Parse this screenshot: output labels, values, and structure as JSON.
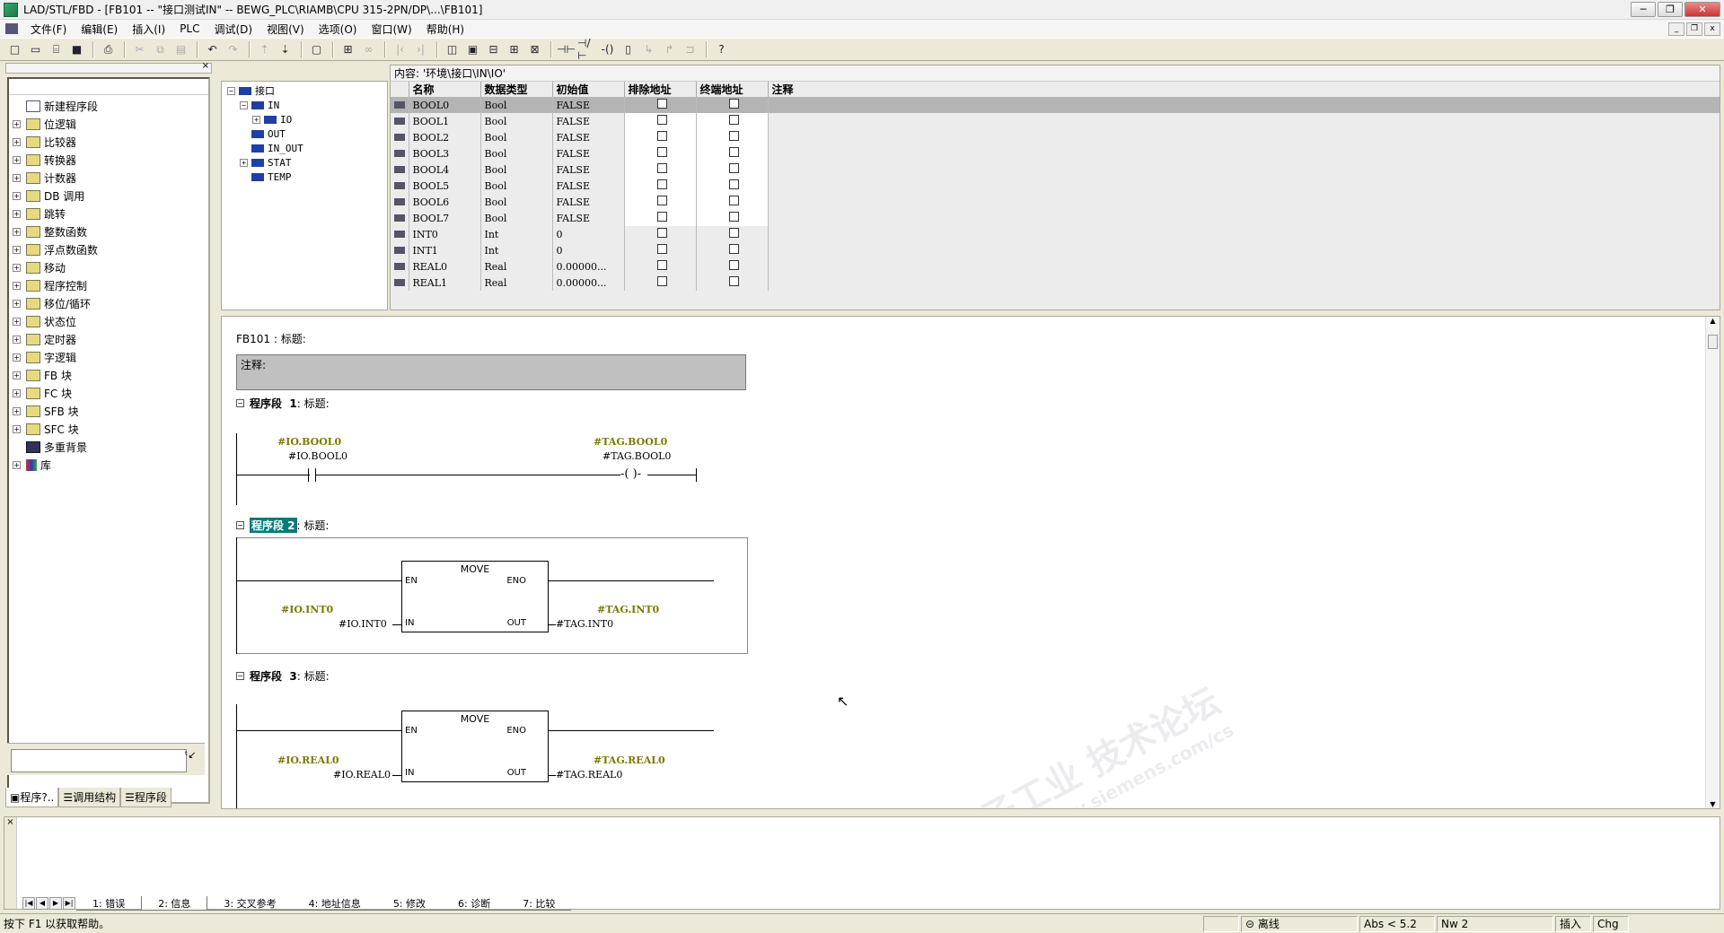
{
  "window": {
    "title": "LAD/STL/FBD  - [FB101 -- \"接口测试IN\" -- BEWG_PLC\\RIAMB\\CPU 315-2PN/DP\\...\\FB101]",
    "btn_min": "─",
    "btn_restore": "❐",
    "btn_close": "✕"
  },
  "menu": [
    "文件(F)",
    "编辑(E)",
    "插入(I)",
    "PLC",
    "调试(D)",
    "视图(V)",
    "选项(O)",
    "窗口(W)",
    "帮助(H)"
  ],
  "sidebar": {
    "items": [
      {
        "label": "新建程序段",
        "expand": "",
        "icon": "new-network-icon"
      },
      {
        "label": "位逻辑",
        "expand": "+",
        "icon": "bit-logic-icon"
      },
      {
        "label": "比较器",
        "expand": "+",
        "icon": "comparator-icon"
      },
      {
        "label": "转换器",
        "expand": "+",
        "icon": "converter-icon"
      },
      {
        "label": "计数器",
        "expand": "+",
        "icon": "counter-icon"
      },
      {
        "label": "DB 调用",
        "expand": "+",
        "icon": "db-call-icon"
      },
      {
        "label": "跳转",
        "expand": "+",
        "icon": "jump-icon"
      },
      {
        "label": "整数函数",
        "expand": "+",
        "icon": "integer-math-icon"
      },
      {
        "label": "浮点数函数",
        "expand": "+",
        "icon": "float-math-icon"
      },
      {
        "label": "移动",
        "expand": "+",
        "icon": "move-icon"
      },
      {
        "label": "程序控制",
        "expand": "+",
        "icon": "program-control-icon"
      },
      {
        "label": "移位/循环",
        "expand": "+",
        "icon": "shift-rotate-icon"
      },
      {
        "label": "状态位",
        "expand": "+",
        "icon": "status-bits-icon"
      },
      {
        "label": "定时器",
        "expand": "+",
        "icon": "timer-icon"
      },
      {
        "label": "字逻辑",
        "expand": "+",
        "icon": "word-logic-icon"
      },
      {
        "label": "FB 块",
        "expand": "+",
        "icon": "fb-block-icon"
      },
      {
        "label": "FC 块",
        "expand": "+",
        "icon": "fc-block-icon"
      },
      {
        "label": "SFB 块",
        "expand": "+",
        "icon": "sfb-block-icon"
      },
      {
        "label": "SFC 块",
        "expand": "+",
        "icon": "sfc-block-icon"
      },
      {
        "label": "多重背景",
        "expand": "",
        "icon": "multi-instance-icon"
      },
      {
        "label": "库",
        "expand": "+",
        "icon": "library-icon"
      }
    ],
    "tabs": [
      "程序?..",
      "调用结构",
      "程序段"
    ]
  },
  "interface_tree": [
    {
      "label": "接口",
      "expand": "−",
      "indent": 0
    },
    {
      "label": "IN",
      "expand": "−",
      "indent": 1
    },
    {
      "label": "IO",
      "expand": "+",
      "indent": 2
    },
    {
      "label": "OUT",
      "expand": "",
      "indent": 1
    },
    {
      "label": "IN_OUT",
      "expand": "",
      "indent": 1
    },
    {
      "label": "STAT",
      "expand": "+",
      "indent": 1
    },
    {
      "label": "TEMP",
      "expand": "",
      "indent": 1
    }
  ],
  "declaration": {
    "content_path": "内容: '环境\\接口\\IN\\IO'",
    "headers": [
      "名称",
      "数据类型",
      "初始值",
      "排除地址",
      "终端地址",
      "注释"
    ],
    "rows": [
      {
        "name": "BOOL0",
        "type": "Bool",
        "init": "FALSE"
      },
      {
        "name": "BOOL1",
        "type": "Bool",
        "init": "FALSE"
      },
      {
        "name": "BOOL2",
        "type": "Bool",
        "init": "FALSE"
      },
      {
        "name": "BOOL3",
        "type": "Bool",
        "init": "FALSE"
      },
      {
        "name": "BOOL4",
        "type": "Bool",
        "init": "FALSE"
      },
      {
        "name": "BOOL5",
        "type": "Bool",
        "init": "FALSE"
      },
      {
        "name": "BOOL6",
        "type": "Bool",
        "init": "FALSE"
      },
      {
        "name": "BOOL7",
        "type": "Bool",
        "init": "FALSE"
      },
      {
        "name": "INT0",
        "type": "Int",
        "init": "0"
      },
      {
        "name": "INT1",
        "type": "Int",
        "init": "0"
      },
      {
        "name": "REAL0",
        "type": "Real",
        "init": "0.00000..."
      },
      {
        "name": "REAL1",
        "type": "Real",
        "init": "0.00000..."
      }
    ]
  },
  "editor": {
    "block_title": "FB101 : 标题:",
    "comment_label": "注释:",
    "nw1": {
      "prefix": "程序段",
      "num": "1",
      "title": ": 标题:",
      "in_sym": "#IO.BOOL0",
      "in_addr": "#IO.BOOL0",
      "out_sym": "#TAG.BOOL0",
      "out_addr": "#TAG.BOOL0"
    },
    "nw2": {
      "label": "程序段 2",
      "title": ": 标题:",
      "box": "MOVE",
      "en": "EN",
      "eno": "ENO",
      "in_pin": "IN",
      "out_pin": "OUT",
      "in_sym": "#IO.INT0",
      "in_addr": "#IO.INT0",
      "out_sym": "#TAG.INT0",
      "out_addr": "#TAG.INT0"
    },
    "nw3": {
      "prefix": "程序段",
      "num": "3",
      "title": ": 标题:",
      "box": "MOVE",
      "en": "EN",
      "eno": "ENO",
      "in_pin": "IN",
      "out_pin": "OUT",
      "in_sym": "#IO.REAL0",
      "in_addr": "#IO.REAL0",
      "out_sym": "#TAG.REAL0",
      "out_addr": "#TAG.REAL0"
    },
    "watermark_main": "西门子工业  技术论坛",
    "watermark_sub": "support.industry.siemens.com/cs"
  },
  "output_tabs": [
    "1: 错误",
    "2: 信息",
    "3: 交叉参考",
    "4: 地址信息",
    "5: 修改",
    "6: 诊断",
    "7: 比较"
  ],
  "status": {
    "help": "按下 F1 以获取帮助。",
    "mode": "离线",
    "abs": "Abs < 5.2",
    "nw": "Nw 2",
    "insert": "插入",
    "chg": "Chg"
  },
  "colors": {
    "symbol": "#7a7a00",
    "selection": "#0a7a7a",
    "comment_bg": "#c0c0c0"
  }
}
